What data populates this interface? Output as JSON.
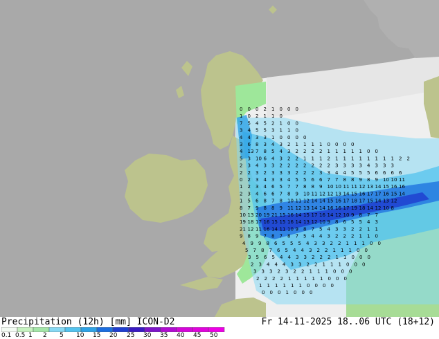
{
  "map": {
    "title_left": "Precipitation (12h) [mm] ICON-D2",
    "title_right": "Fr 14-11-2025 18..06 UTC (18+12)",
    "colors": {
      "background_outside": "#a9a9a9",
      "land": "#bcc38d",
      "sea_inside_domain": "#f0f0f0",
      "no_data_domain": "#e9e9e9"
    },
    "legend": {
      "labels": [
        "0.1",
        "0.5",
        "1",
        "2",
        "5",
        "10",
        "15",
        "20",
        "25",
        "30",
        "35",
        "40",
        "45",
        "50"
      ],
      "colors": [
        "#f4fcf4",
        "#c6f2c0",
        "#a4e6a8",
        "#86d9f4",
        "#53c3ee",
        "#2fa3e6",
        "#1c6ee0",
        "#1f3fd0",
        "#3a1bc2",
        "#7d14c9",
        "#b10cd2",
        "#d506d9",
        "#e004dc",
        "#ee00e6"
      ]
    },
    "grid_values": [
      [
        "0",
        "0",
        "0",
        "2",
        "1",
        "0",
        "0",
        "0"
      ],
      [
        "1",
        "0",
        "2",
        "1",
        "1",
        "0"
      ],
      [
        "7",
        "5",
        "4",
        "5",
        "2",
        "1",
        "0",
        "0"
      ],
      [
        "3",
        "4",
        "5",
        "5",
        "3",
        "1",
        "1",
        "0"
      ],
      [
        "4",
        "4",
        "3",
        "3",
        "1",
        "0",
        "0",
        "0",
        "0"
      ],
      [
        "3",
        "6",
        "8",
        "3",
        "4",
        "3",
        "2",
        "1",
        "1",
        "1",
        "1",
        "0",
        "0",
        "0",
        "0"
      ],
      [
        "4",
        "13",
        "7",
        "8",
        "5",
        "4",
        "3",
        "2",
        "2",
        "2",
        "2",
        "1",
        "1",
        "1",
        "1",
        "1",
        "0",
        "0"
      ],
      [
        "5",
        "3",
        "10",
        "6",
        "4",
        "3",
        "2",
        "2",
        "1",
        "1",
        "1",
        "2",
        "1",
        "1",
        "1",
        "1",
        "1",
        "1",
        "1",
        "1",
        "2",
        "2"
      ],
      [
        "2",
        "3",
        "4",
        "3",
        "3",
        "2",
        "2",
        "2",
        "2",
        "2",
        "2",
        "2",
        "3",
        "3",
        "3",
        "3",
        "4",
        "3",
        "3",
        "3"
      ],
      [
        "2",
        "2",
        "3",
        "2",
        "3",
        "3",
        "3",
        "2",
        "2",
        "2",
        "3",
        "3",
        "4",
        "4",
        "5",
        "5",
        "5",
        "6",
        "6",
        "6",
        "6"
      ],
      [
        "0",
        "2",
        "3",
        "4",
        "3",
        "3",
        "4",
        "5",
        "5",
        "6",
        "6",
        "7",
        "7",
        "8",
        "8",
        "9",
        "8",
        "9",
        "10",
        "10",
        "11"
      ],
      [
        "1",
        "2",
        "3",
        "4",
        "6",
        "5",
        "7",
        "7",
        "8",
        "8",
        "9",
        "10",
        "10",
        "11",
        "11",
        "12",
        "13",
        "14",
        "15",
        "16",
        "16"
      ],
      [
        "2",
        "3",
        "4",
        "6",
        "6",
        "7",
        "8",
        "9",
        "10",
        "11",
        "12",
        "12",
        "13",
        "14",
        "15",
        "16",
        "17",
        "17",
        "16",
        "15",
        "14"
      ],
      [
        "1",
        "5",
        "6",
        "8",
        "7",
        "8",
        "10",
        "11",
        "12",
        "14",
        "14",
        "15",
        "16",
        "17",
        "18",
        "17",
        "15",
        "14",
        "13",
        "12"
      ],
      [
        "8",
        "7",
        "9",
        "8",
        "8",
        "9",
        "11",
        "12",
        "13",
        "14",
        "14",
        "16",
        "16",
        "17",
        "19",
        "18",
        "14",
        "12",
        "10",
        "8"
      ],
      [
        "10",
        "13",
        "20",
        "19",
        "21",
        "15",
        "16",
        "14",
        "15",
        "17",
        "16",
        "14",
        "12",
        "10",
        "9",
        "8",
        "7",
        "7"
      ],
      [
        "19",
        "18",
        "17",
        "16",
        "15",
        "15",
        "16",
        "14",
        "13",
        "12",
        "10",
        "9",
        "8",
        "6",
        "5",
        "5",
        "4",
        "3"
      ],
      [
        "21",
        "12",
        "11",
        "16",
        "14",
        "11",
        "10",
        "9",
        "8",
        "7",
        "5",
        "4",
        "3",
        "3",
        "2",
        "2",
        "1",
        "1"
      ],
      [
        "9",
        "8",
        "9",
        "7",
        "8",
        "7",
        "8",
        "7",
        "5",
        "4",
        "4",
        "3",
        "2",
        "2",
        "2",
        "1",
        "1",
        "0"
      ],
      [
        "4",
        "9",
        "9",
        "8",
        "6",
        "5",
        "5",
        "5",
        "4",
        "3",
        "3",
        "2",
        "2",
        "1",
        "1",
        "1",
        "0",
        "0"
      ],
      [
        "5",
        "7",
        "8",
        "7",
        "6",
        "5",
        "4",
        "4",
        "3",
        "2",
        "2",
        "1",
        "1",
        "1",
        "0",
        "0"
      ],
      [
        "3",
        "5",
        "6",
        "5",
        "4",
        "4",
        "3",
        "3",
        "2",
        "2",
        "2",
        "1",
        "1",
        "0",
        "0",
        "0"
      ],
      [
        "2",
        "3",
        "4",
        "4",
        "4",
        "3",
        "3",
        "2",
        "2",
        "1",
        "1",
        "1",
        "0",
        "0",
        "0"
      ],
      [
        "3",
        "3",
        "3",
        "2",
        "3",
        "2",
        "2",
        "1",
        "1",
        "1",
        "0",
        "0",
        "0"
      ],
      [
        "2",
        "2",
        "2",
        "2",
        "1",
        "1",
        "1",
        "1",
        "1",
        "0",
        "0",
        "0"
      ],
      [
        "1",
        "1",
        "1",
        "1",
        "1",
        "1",
        "0",
        "0",
        "0",
        "0"
      ],
      [
        "0",
        "0",
        "0",
        "1",
        "0",
        "0",
        "0"
      ]
    ]
  }
}
